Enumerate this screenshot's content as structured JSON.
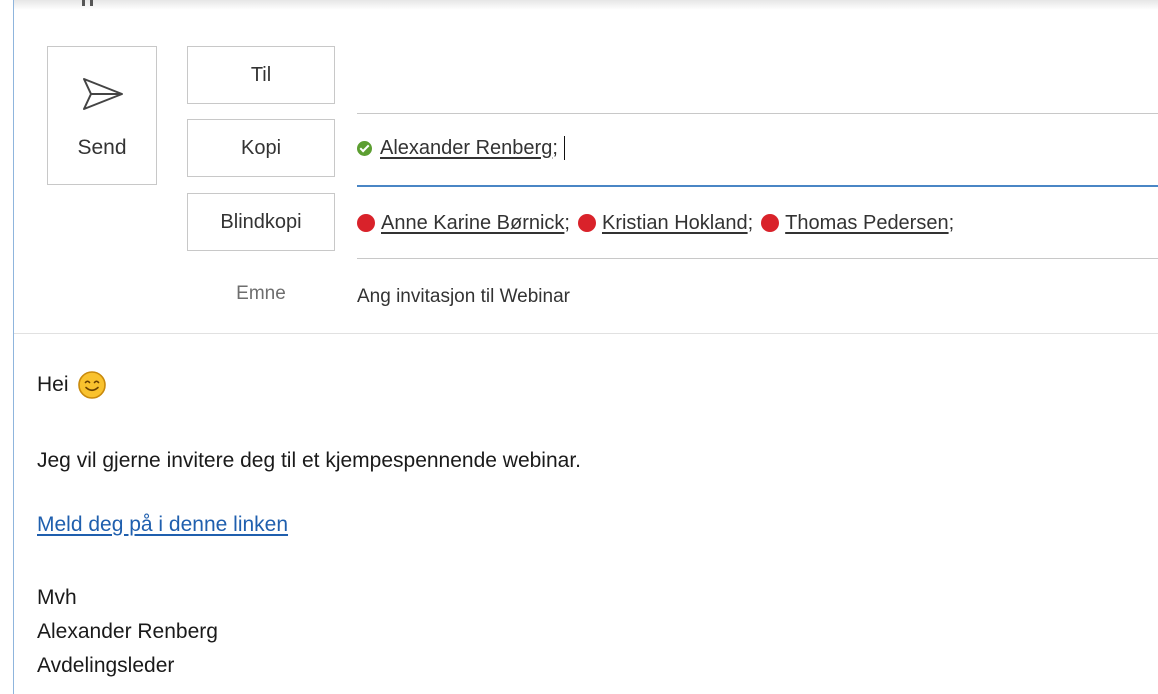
{
  "header": {
    "send_label": "Send",
    "to_label": "Til",
    "cc_label": "Kopi",
    "bcc_label": "Blindkopi",
    "subject_label": "Emne",
    "subject_value": "Ang invitasjon til Webinar"
  },
  "cc": [
    {
      "name": "Alexander Renberg",
      "status": "available",
      "status_color": "#5c9e31",
      "separator": ";"
    }
  ],
  "bcc": [
    {
      "name": "Anne Karine Børnick",
      "status": "busy",
      "status_color": "#d9222a",
      "separator": ";"
    },
    {
      "name": "Kristian Hokland",
      "status": "busy",
      "status_color": "#d9222a",
      "separator": ";"
    },
    {
      "name": "Thomas Pedersen",
      "status": "busy",
      "status_color": "#d9222a",
      "separator": ";"
    }
  ],
  "body": {
    "greeting": "Hei",
    "greeting_emoji": "smiley-emoji",
    "paragraph": "Jeg vil gjerne invitere deg til et kjempespennende webinar.",
    "link_text": "Meld deg på i denne linken",
    "signoff": "Mvh",
    "sender_name": "Alexander Renberg",
    "sender_title": "Avdelingsleder"
  },
  "colors": {
    "accent": "#4a86c5",
    "link": "#1f5fae",
    "busy": "#d9222a",
    "available": "#5c9e31"
  }
}
